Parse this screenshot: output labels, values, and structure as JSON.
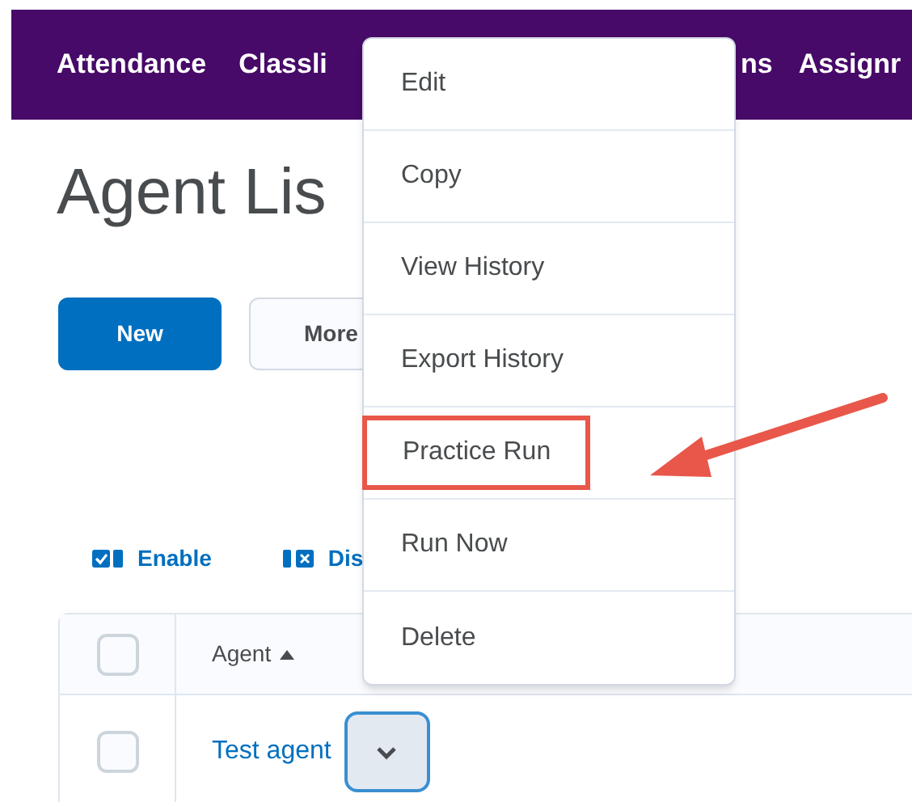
{
  "nav": [
    {
      "label": "Attendance"
    },
    {
      "label": "Classli"
    },
    {
      "label": "ns"
    },
    {
      "label": "Assignr"
    }
  ],
  "heading": "Agent Lis",
  "buttons": [
    {
      "label": "New",
      "kind": "primary"
    },
    {
      "label": "More",
      "kind": "secondary"
    }
  ],
  "actions": [
    {
      "label": "Enable",
      "kind": "enable"
    },
    {
      "label": "Dis",
      "kind": "disable"
    }
  ],
  "table": {
    "header": {
      "checked": false,
      "column": "Agent",
      "sort_ascending": true
    },
    "rows": [
      {
        "name": "Test agent",
        "checked": false
      }
    ]
  },
  "menu": {
    "items": [
      {
        "label": "Edit",
        "highlighted": false
      },
      {
        "label": "Copy",
        "highlighted": false
      },
      {
        "label": "View History",
        "highlighted": false
      },
      {
        "label": "Export History",
        "highlighted": false
      },
      {
        "label": "Practice Run",
        "highlighted": true
      },
      {
        "label": "Run Now",
        "highlighted": false
      },
      {
        "label": "Delete",
        "highlighted": false
      }
    ]
  }
}
